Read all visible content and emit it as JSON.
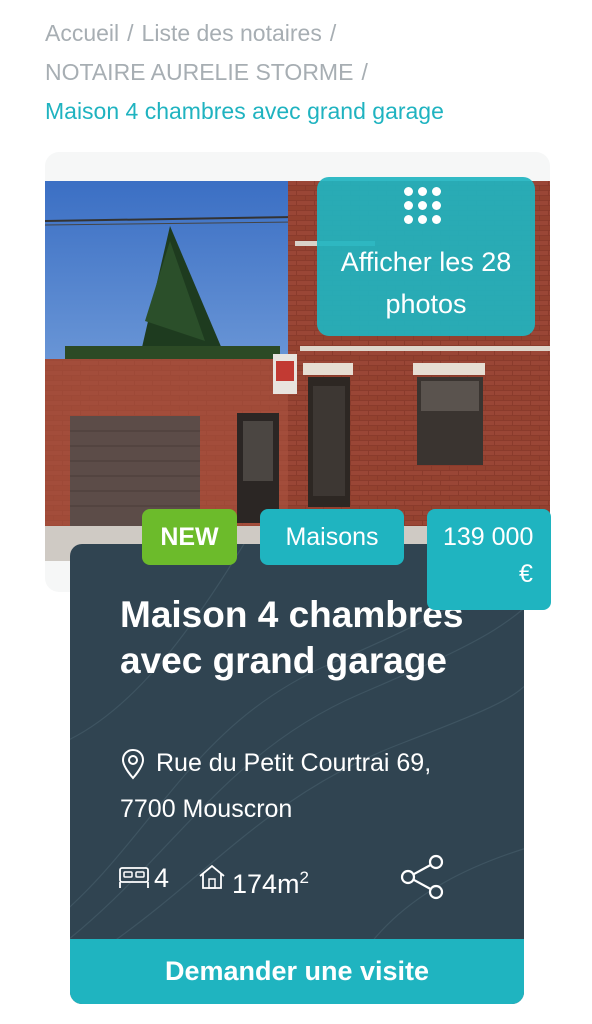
{
  "breadcrumb": {
    "home": "Accueil",
    "notaries_list": "Liste des notaires",
    "notary": "NOTAIRE AURELIE STORME",
    "current": "Maison 4 chambres avec grand garage",
    "separator": "/"
  },
  "gallery": {
    "button_label": "Afficher les 28 photos",
    "icon": "grid-icon"
  },
  "badges": {
    "new": "NEW",
    "type": "Maisons",
    "price": "139 000",
    "currency": "€"
  },
  "listing": {
    "title": "Maison 4 chambres avec grand garage",
    "address_line1": "Rue du Petit Courtrai 69,",
    "address_line2": "7700 Mouscron",
    "bedrooms": "4",
    "area": "174m",
    "area_unit_sup": "2"
  },
  "actions": {
    "visit_button": "Demander une visite",
    "share_icon": "share-icon"
  },
  "colors": {
    "accent": "#1fb4c0",
    "new_badge": "#6cbb2b",
    "panel": "#304451",
    "muted_text": "#a7aeb3"
  }
}
